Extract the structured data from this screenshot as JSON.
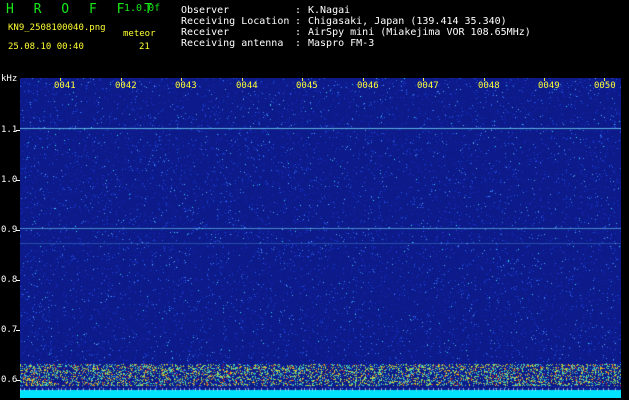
{
  "app": {
    "name": "H R O F F T",
    "version": "1.0.0f"
  },
  "file": {
    "name": "KN9_2508100040.png",
    "datetime": "25.08.10 00:40"
  },
  "meteor": {
    "label": "meteor",
    "count": "21"
  },
  "info": [
    {
      "label": "Observer",
      "sep": ":",
      "value": "K.Nagai"
    },
    {
      "label": "Receiving Location",
      "sep": ":",
      "value": "Chigasaki, Japan (139.414 35.340)"
    },
    {
      "label": "Receiver",
      "sep": ":",
      "value": "AirSpy mini (Miakejima VOR 108.65MHz)"
    },
    {
      "label": "Receiving antenna",
      "sep": ":",
      "value": "Maspro FM-3"
    }
  ],
  "axis": {
    "unit": "kHz",
    "y_ticks": [
      "1.1",
      "1.0",
      "0.9",
      "0.8",
      "0.7",
      "0.6"
    ],
    "x_ticks": [
      "0041",
      "0042",
      "0043",
      "0044",
      "0045",
      "0046",
      "0047",
      "0048",
      "0049",
      "0050"
    ]
  },
  "colors": {
    "background": "#0c1a8a",
    "noise_low": "#1730c8",
    "noise_high": "#2ee6f5",
    "carrier_band": "#e8d020",
    "baseline": "#00e5ff"
  }
}
